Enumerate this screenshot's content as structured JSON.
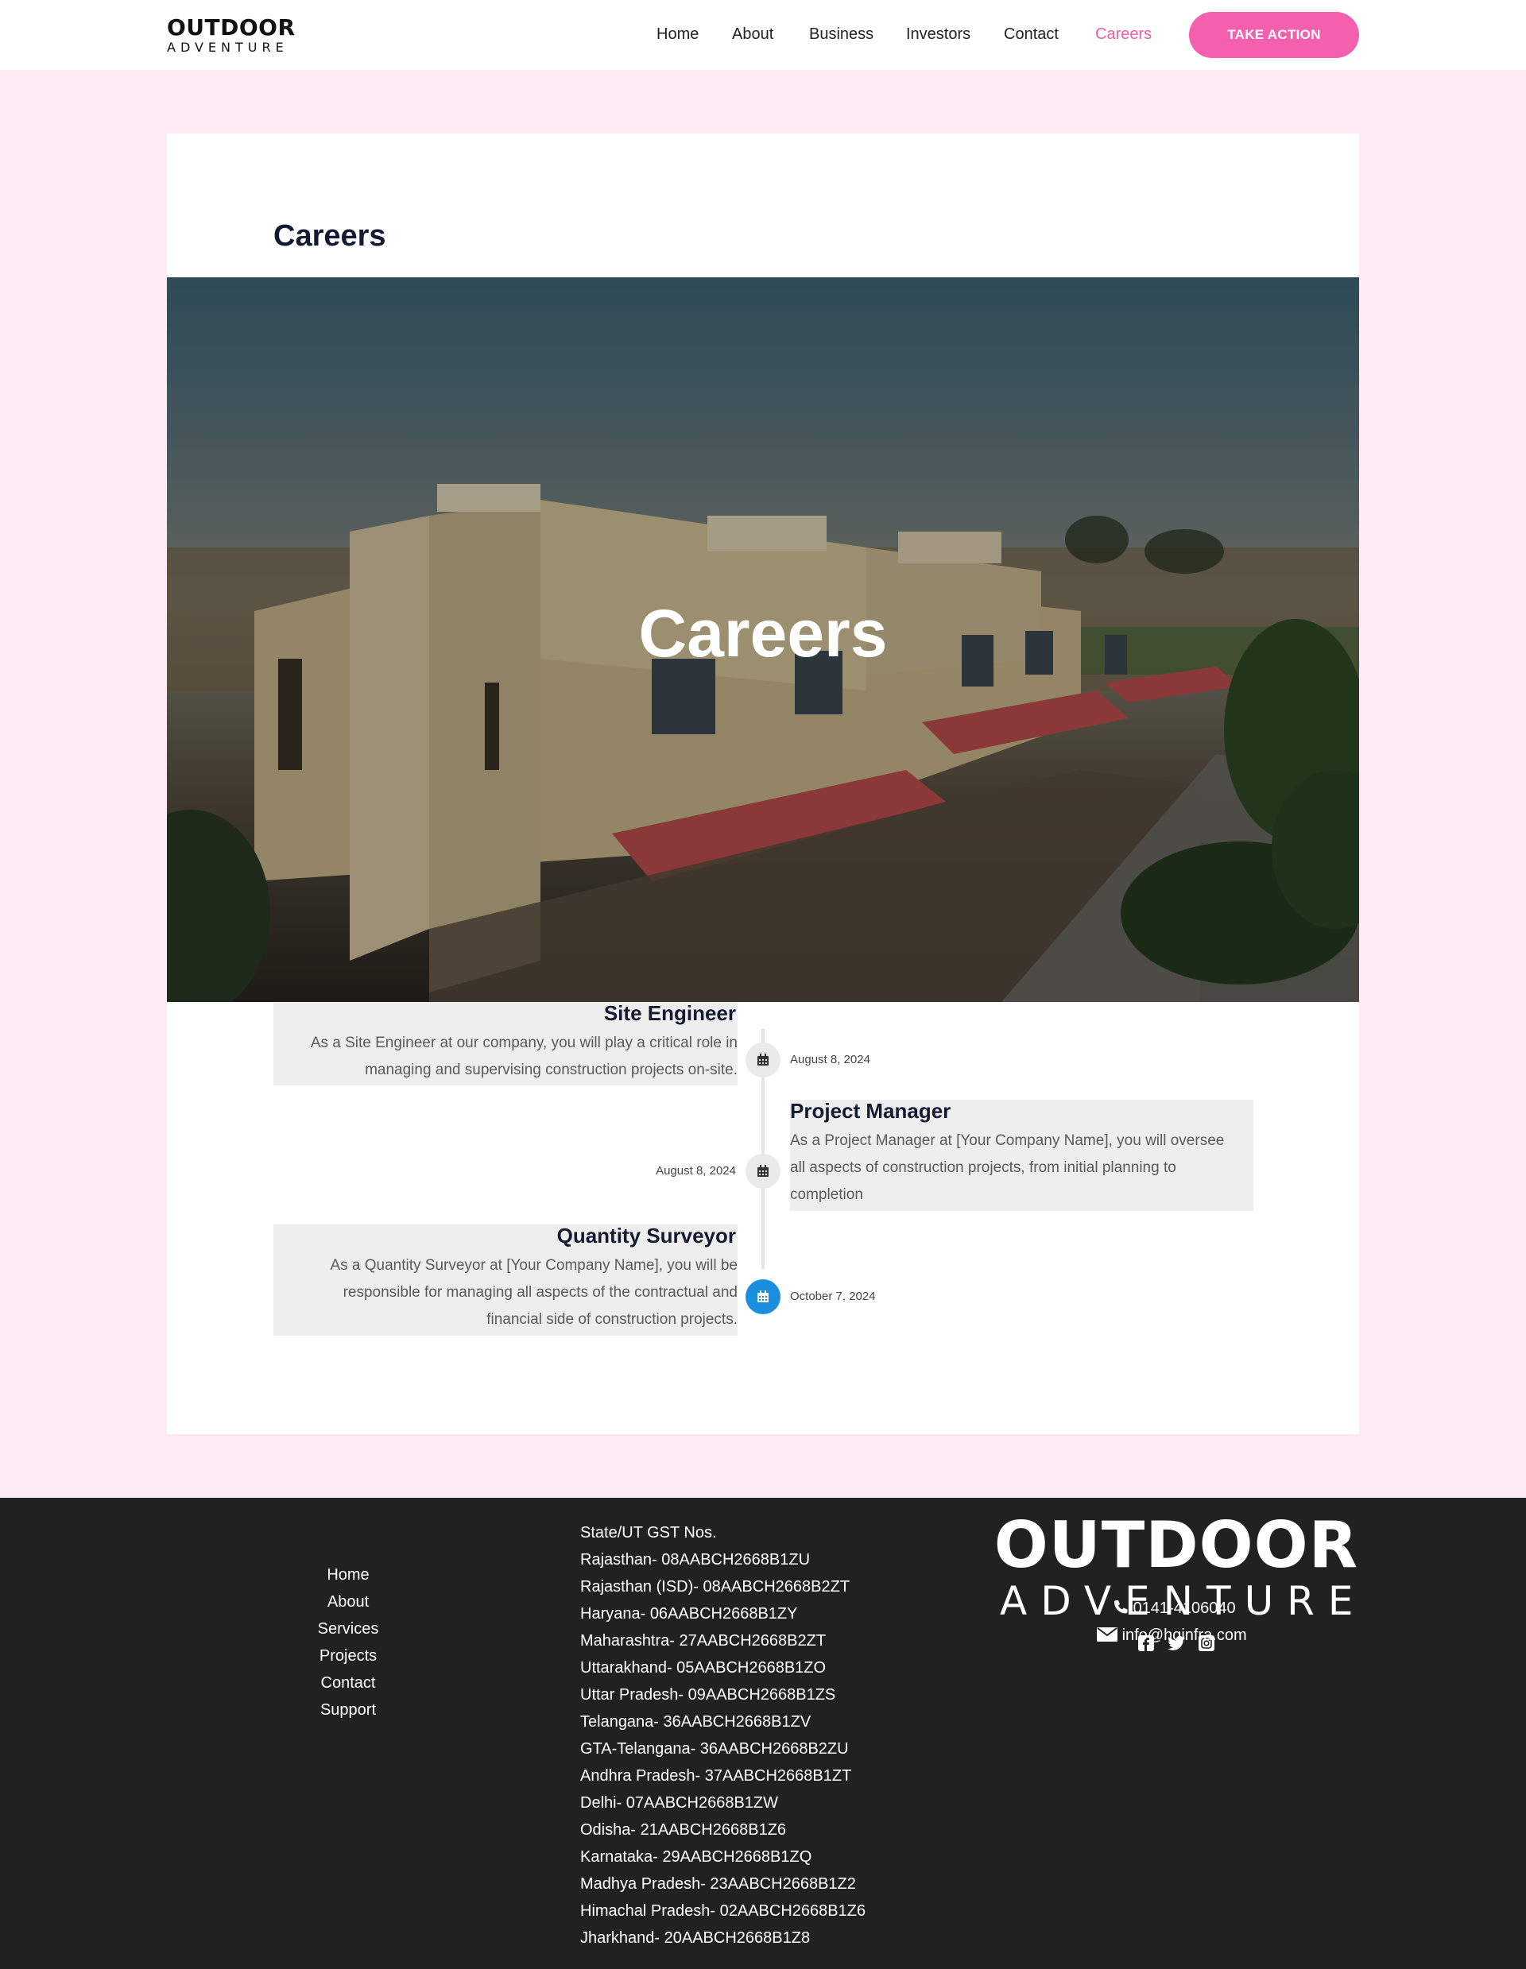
{
  "header": {
    "logo_top": "OUTDOOR",
    "logo_bottom": "ADVENTURE",
    "nav": [
      {
        "label": "Home"
      },
      {
        "label": "About"
      },
      {
        "label": "Business"
      },
      {
        "label": "Investors"
      },
      {
        "label": "Contact"
      },
      {
        "label": "Careers",
        "active": true
      }
    ],
    "cta_label": "TAKE ACTION"
  },
  "main": {
    "page_title": "Careers",
    "hero_title": "Careers",
    "timeline": [
      {
        "title": "Site Engineer",
        "text": "As a Site Engineer at our company, you will play a critical role in managing and supervising construction projects on-site.",
        "date": "August 8, 2024",
        "side": "left"
      },
      {
        "title": "Project Manager",
        "text": "As a Project Manager at [Your Company Name], you will oversee all aspects of construction projects, from initial planning to completion",
        "date": "August 8, 2024",
        "side": "right"
      },
      {
        "title": "Quantity Surveyor",
        "text": "As a Quantity Surveyor at [Your Company Name], you will be responsible for managing all aspects of the contractual and financial side of construction projects.",
        "date": "October 7, 2024",
        "side": "left"
      }
    ]
  },
  "footer": {
    "links": [
      "Home",
      "About",
      "Services",
      "Projects",
      "Contact",
      "Support"
    ],
    "gst_heading": "State/UT GST Nos.",
    "gst": [
      "Rajasthan- 08AABCH2668B1ZU",
      "Rajasthan (ISD)- 08AABCH2668B2ZT",
      "Haryana- 06AABCH2668B1ZY",
      "Maharashtra- 27AABCH2668B2ZT",
      "Uttarakhand- 05AABCH2668B1ZO",
      "Uttar Pradesh- 09AABCH2668B1ZS",
      "Telangana- 36AABCH2668B1ZV",
      "GTA-Telangana- 36AABCH2668B2ZU",
      "Andhra Pradesh- 37AABCH2668B1ZT",
      "Delhi- 07AABCH2668B1ZW",
      "Odisha- 21AABCH2668B1Z6",
      "Karnataka- 29AABCH2668B1ZQ",
      "Madhya Pradesh- 23AABCH2668B1Z2",
      "Himachal Pradesh- 02AABCH2668B1Z6",
      "Jharkhand- 20AABCH2668B1Z8"
    ],
    "logo_top": "OUTDOOR",
    "logo_bottom": "ADVENTURE",
    "social_icons": [
      "facebook-icon",
      "twitter-icon",
      "instagram-icon"
    ],
    "phone": "0141-4106040",
    "email": "info@hginfra.com"
  },
  "colors": {
    "accent": "#f560ae",
    "page_bg": "#fcebf3",
    "footer_bg": "#212121",
    "dot_blue": "#1a8fe0"
  }
}
